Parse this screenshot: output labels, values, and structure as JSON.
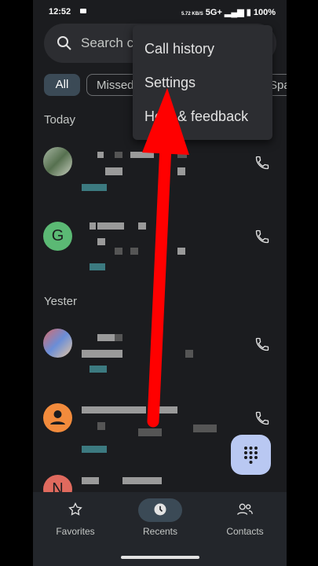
{
  "status_bar": {
    "time": "12:52",
    "speed": "5.72 KB/S",
    "network": "5G+",
    "battery": "100%"
  },
  "search": {
    "placeholder": "Search c"
  },
  "filters": {
    "all": "All",
    "missed": "Missed",
    "third": "Spa"
  },
  "sections": {
    "today": "Today",
    "yesterday": "Yester"
  },
  "contacts": {
    "g_initial": "G",
    "n_initial": "N"
  },
  "menu": {
    "items": [
      "Call history",
      "Settings",
      "Help & feedback"
    ]
  },
  "nav": {
    "favorites": "Favorites",
    "recents": "Recents",
    "contacts": "Contacts"
  },
  "colors": {
    "accent_arrow": "#ff0000",
    "fab": "#b9c8f2",
    "chip_active": "#3b4a56"
  }
}
